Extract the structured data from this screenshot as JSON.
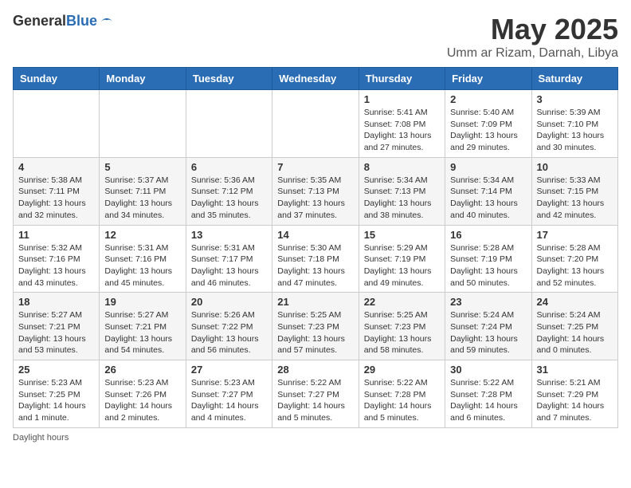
{
  "logo": {
    "general": "General",
    "blue": "Blue"
  },
  "title": "May 2025",
  "subtitle": "Umm ar Rizam, Darnah, Libya",
  "days_of_week": [
    "Sunday",
    "Monday",
    "Tuesday",
    "Wednesday",
    "Thursday",
    "Friday",
    "Saturday"
  ],
  "weeks": [
    [
      {
        "day": "",
        "info": ""
      },
      {
        "day": "",
        "info": ""
      },
      {
        "day": "",
        "info": ""
      },
      {
        "day": "",
        "info": ""
      },
      {
        "day": "1",
        "info": "Sunrise: 5:41 AM\nSunset: 7:08 PM\nDaylight: 13 hours and 27 minutes."
      },
      {
        "day": "2",
        "info": "Sunrise: 5:40 AM\nSunset: 7:09 PM\nDaylight: 13 hours and 29 minutes."
      },
      {
        "day": "3",
        "info": "Sunrise: 5:39 AM\nSunset: 7:10 PM\nDaylight: 13 hours and 30 minutes."
      }
    ],
    [
      {
        "day": "4",
        "info": "Sunrise: 5:38 AM\nSunset: 7:11 PM\nDaylight: 13 hours and 32 minutes."
      },
      {
        "day": "5",
        "info": "Sunrise: 5:37 AM\nSunset: 7:11 PM\nDaylight: 13 hours and 34 minutes."
      },
      {
        "day": "6",
        "info": "Sunrise: 5:36 AM\nSunset: 7:12 PM\nDaylight: 13 hours and 35 minutes."
      },
      {
        "day": "7",
        "info": "Sunrise: 5:35 AM\nSunset: 7:13 PM\nDaylight: 13 hours and 37 minutes."
      },
      {
        "day": "8",
        "info": "Sunrise: 5:34 AM\nSunset: 7:13 PM\nDaylight: 13 hours and 38 minutes."
      },
      {
        "day": "9",
        "info": "Sunrise: 5:34 AM\nSunset: 7:14 PM\nDaylight: 13 hours and 40 minutes."
      },
      {
        "day": "10",
        "info": "Sunrise: 5:33 AM\nSunset: 7:15 PM\nDaylight: 13 hours and 42 minutes."
      }
    ],
    [
      {
        "day": "11",
        "info": "Sunrise: 5:32 AM\nSunset: 7:16 PM\nDaylight: 13 hours and 43 minutes."
      },
      {
        "day": "12",
        "info": "Sunrise: 5:31 AM\nSunset: 7:16 PM\nDaylight: 13 hours and 45 minutes."
      },
      {
        "day": "13",
        "info": "Sunrise: 5:31 AM\nSunset: 7:17 PM\nDaylight: 13 hours and 46 minutes."
      },
      {
        "day": "14",
        "info": "Sunrise: 5:30 AM\nSunset: 7:18 PM\nDaylight: 13 hours and 47 minutes."
      },
      {
        "day": "15",
        "info": "Sunrise: 5:29 AM\nSunset: 7:19 PM\nDaylight: 13 hours and 49 minutes."
      },
      {
        "day": "16",
        "info": "Sunrise: 5:28 AM\nSunset: 7:19 PM\nDaylight: 13 hours and 50 minutes."
      },
      {
        "day": "17",
        "info": "Sunrise: 5:28 AM\nSunset: 7:20 PM\nDaylight: 13 hours and 52 minutes."
      }
    ],
    [
      {
        "day": "18",
        "info": "Sunrise: 5:27 AM\nSunset: 7:21 PM\nDaylight: 13 hours and 53 minutes."
      },
      {
        "day": "19",
        "info": "Sunrise: 5:27 AM\nSunset: 7:21 PM\nDaylight: 13 hours and 54 minutes."
      },
      {
        "day": "20",
        "info": "Sunrise: 5:26 AM\nSunset: 7:22 PM\nDaylight: 13 hours and 56 minutes."
      },
      {
        "day": "21",
        "info": "Sunrise: 5:25 AM\nSunset: 7:23 PM\nDaylight: 13 hours and 57 minutes."
      },
      {
        "day": "22",
        "info": "Sunrise: 5:25 AM\nSunset: 7:23 PM\nDaylight: 13 hours and 58 minutes."
      },
      {
        "day": "23",
        "info": "Sunrise: 5:24 AM\nSunset: 7:24 PM\nDaylight: 13 hours and 59 minutes."
      },
      {
        "day": "24",
        "info": "Sunrise: 5:24 AM\nSunset: 7:25 PM\nDaylight: 14 hours and 0 minutes."
      }
    ],
    [
      {
        "day": "25",
        "info": "Sunrise: 5:23 AM\nSunset: 7:25 PM\nDaylight: 14 hours and 1 minute."
      },
      {
        "day": "26",
        "info": "Sunrise: 5:23 AM\nSunset: 7:26 PM\nDaylight: 14 hours and 2 minutes."
      },
      {
        "day": "27",
        "info": "Sunrise: 5:23 AM\nSunset: 7:27 PM\nDaylight: 14 hours and 4 minutes."
      },
      {
        "day": "28",
        "info": "Sunrise: 5:22 AM\nSunset: 7:27 PM\nDaylight: 14 hours and 5 minutes."
      },
      {
        "day": "29",
        "info": "Sunrise: 5:22 AM\nSunset: 7:28 PM\nDaylight: 14 hours and 5 minutes."
      },
      {
        "day": "30",
        "info": "Sunrise: 5:22 AM\nSunset: 7:28 PM\nDaylight: 14 hours and 6 minutes."
      },
      {
        "day": "31",
        "info": "Sunrise: 5:21 AM\nSunset: 7:29 PM\nDaylight: 14 hours and 7 minutes."
      }
    ]
  ],
  "footer": "Daylight hours"
}
